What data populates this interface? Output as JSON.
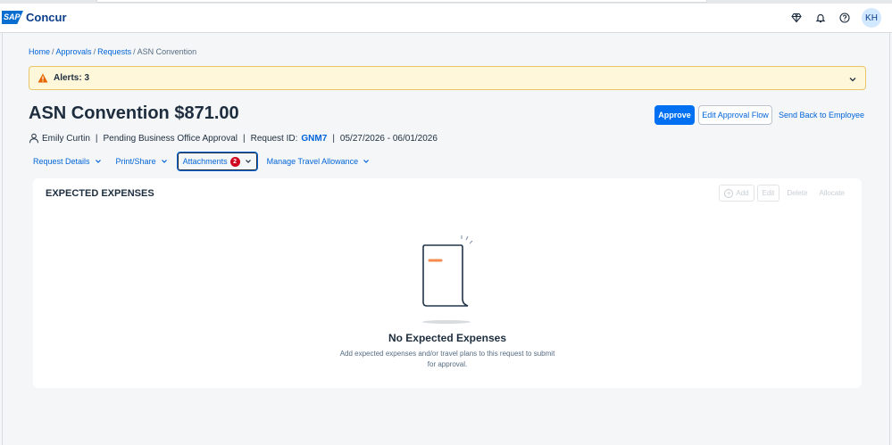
{
  "header": {
    "logo_badge": "SAP",
    "logo_text": "Concur",
    "icons": [
      "diamond-icon",
      "bell-icon",
      "help-icon"
    ],
    "avatar_initials": "KH"
  },
  "breadcrumb": {
    "items": [
      "Home",
      "Approvals",
      "Requests",
      "ASN Convention"
    ],
    "separator": "/"
  },
  "alert": {
    "text": "Alerts: 3"
  },
  "request": {
    "title": "ASN Convention $871.00",
    "employee": "Emily Curtin",
    "status": "Pending Business Office Approval",
    "request_id_label": "Request ID:",
    "request_id": "GNM7",
    "dates": "05/27/2026 - 06/01/2026",
    "pipe": "|"
  },
  "actions": {
    "approve": "Approve",
    "edit_flow": "Edit Approval Flow",
    "send_back": "Send Back to Employee"
  },
  "tabs": [
    {
      "label": "Request Details"
    },
    {
      "label": "Print/Share"
    },
    {
      "label": "Attachments",
      "badge": "2"
    },
    {
      "label": "Manage Travel Allowance"
    }
  ],
  "expenses": {
    "title": "EXPECTED EXPENSES",
    "actions": {
      "add": "Add",
      "edit": "Edit",
      "delete": "Delete",
      "allocate": "Allocate"
    },
    "empty_title": "No Expected Expenses",
    "empty_desc": "Add expected expenses and/or travel plans to this request to submit for approval."
  },
  "colors": {
    "accent": "#0070f2",
    "link": "#0064d9",
    "alert_bg": "#fef7d9",
    "badge": "#d0041f"
  }
}
